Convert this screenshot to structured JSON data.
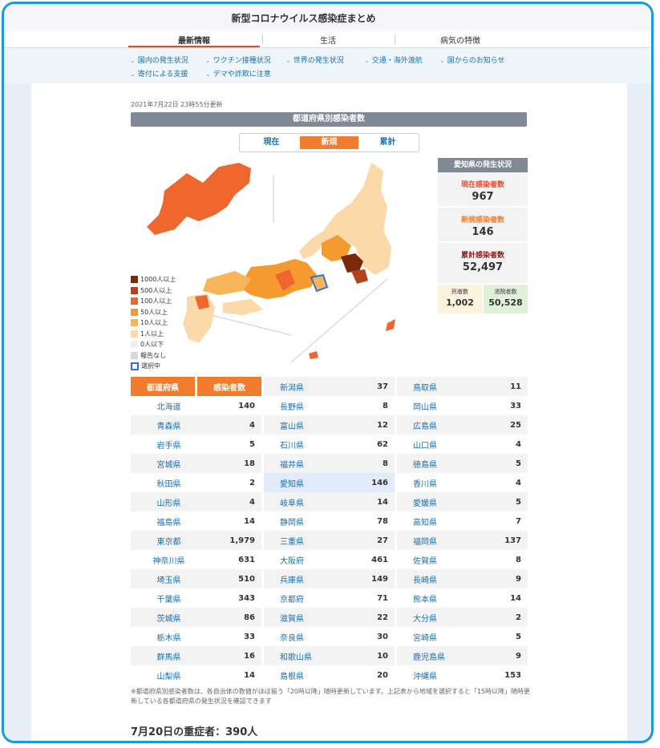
{
  "site_title": "新型コロナウイルス感染症まとめ",
  "nav_tabs": [
    "最新情報",
    "生活",
    "病気の特徴"
  ],
  "sub_nav": [
    "国内の発生状況",
    "ワクチン接種状況",
    "世界の発生状況",
    "交通・海外渡航",
    "国からのお知らせ",
    "寄付による支援",
    "デマや詐欺に注意"
  ],
  "updated": "2021年7月22日 23時55分更新",
  "map_header": "都道府県別感染者数",
  "toggle": [
    "現在",
    "新規",
    "累計"
  ],
  "legend": [
    {
      "label": "1000人以上",
      "color": "#7a2a0a"
    },
    {
      "label": "500人以上",
      "color": "#b4421a"
    },
    {
      "label": "100人以上",
      "color": "#f0672e"
    },
    {
      "label": "50人以上",
      "color": "#f59a2e"
    },
    {
      "label": "10人以上",
      "color": "#f7b65a"
    },
    {
      "label": "1人以上",
      "color": "#fbd9a8"
    },
    {
      "label": "0人以下",
      "color": "#eeeeee"
    },
    {
      "label": "報告なし",
      "color": "#d8d8d8"
    },
    {
      "label": "選択中",
      "color": "#3c6fd0"
    }
  ],
  "status": {
    "title": "愛知県の発生状況",
    "current_label": "現在感染者数",
    "current_value": "967",
    "new_label": "新規感染者数",
    "new_value": "146",
    "total_label": "累計感染者数",
    "total_value": "52,497",
    "deaths_label": "死者数",
    "deaths_value": "1,002",
    "recovered_label": "退院者数",
    "recovered_value": "50,528"
  },
  "table_headers": [
    "都道府県",
    "感染者数"
  ],
  "prefectures": [
    [
      "北海道",
      "140"
    ],
    [
      "青森県",
      "4"
    ],
    [
      "岩手県",
      "5"
    ],
    [
      "宮城県",
      "18"
    ],
    [
      "秋田県",
      "2"
    ],
    [
      "山形県",
      "4"
    ],
    [
      "福島県",
      "14"
    ],
    [
      "東京都",
      "1,979"
    ],
    [
      "神奈川県",
      "631"
    ],
    [
      "埼玉県",
      "510"
    ],
    [
      "千葉県",
      "343"
    ],
    [
      "茨城県",
      "86"
    ],
    [
      "栃木県",
      "33"
    ],
    [
      "群馬県",
      "16"
    ],
    [
      "山梨県",
      "14"
    ],
    [
      "新潟県",
      "37"
    ],
    [
      "長野県",
      "8"
    ],
    [
      "富山県",
      "12"
    ],
    [
      "石川県",
      "62"
    ],
    [
      "福井県",
      "8"
    ],
    [
      "愛知県",
      "146"
    ],
    [
      "岐阜県",
      "14"
    ],
    [
      "静岡県",
      "78"
    ],
    [
      "三重県",
      "27"
    ],
    [
      "大阪府",
      "461"
    ],
    [
      "兵庫県",
      "149"
    ],
    [
      "京都府",
      "71"
    ],
    [
      "滋賀県",
      "22"
    ],
    [
      "奈良県",
      "30"
    ],
    [
      "和歌山県",
      "10"
    ],
    [
      "島根県",
      "20"
    ],
    [
      "鳥取県",
      "11"
    ],
    [
      "岡山県",
      "33"
    ],
    [
      "広島県",
      "25"
    ],
    [
      "山口県",
      "4"
    ],
    [
      "徳島県",
      "5"
    ],
    [
      "香川県",
      "4"
    ],
    [
      "愛媛県",
      "5"
    ],
    [
      "高知県",
      "7"
    ],
    [
      "福岡県",
      "137"
    ],
    [
      "佐賀県",
      "8"
    ],
    [
      "長崎県",
      "9"
    ],
    [
      "熊本県",
      "14"
    ],
    [
      "大分県",
      "2"
    ],
    [
      "宮崎県",
      "5"
    ],
    [
      "鹿児島県",
      "9"
    ],
    [
      "沖縄県",
      "153"
    ]
  ],
  "note": "※都道府県別感染者数は、各自治体の数値がほぼ揃う「20時以降」随時更新しています。上記表から地域を選択すると「15時以降」随時更新している各都道府県の発生状況を確認できます",
  "severe": "7月20日の重症者：390人"
}
